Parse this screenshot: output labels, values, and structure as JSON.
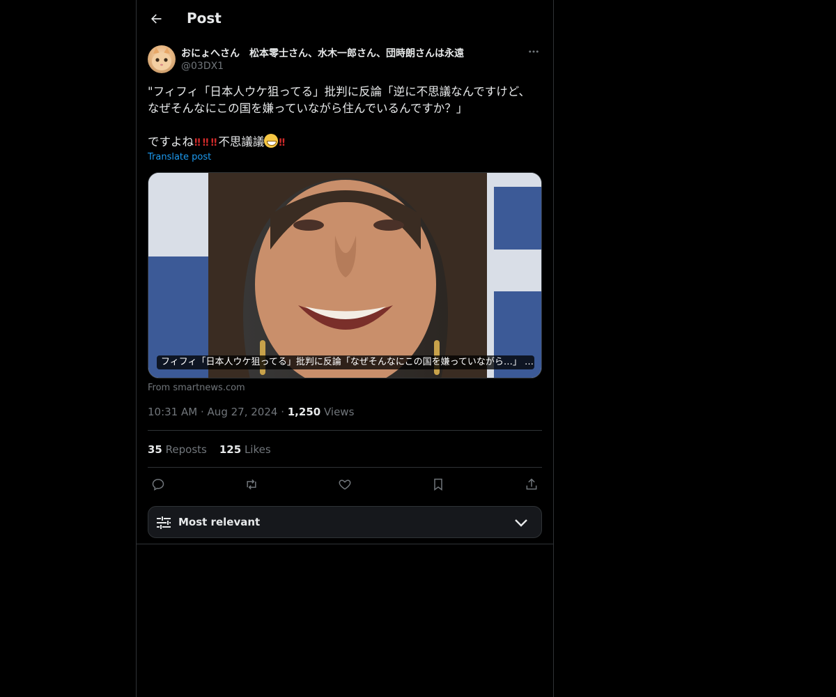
{
  "header": {
    "title": "Post",
    "back_icon": "arrow-left-icon"
  },
  "post": {
    "author": {
      "display_name": "おにょへさん　松本零士さん、水木一郎さん、団時朗さんは永遠",
      "handle": "@03DX1",
      "avatar": "cat-avatar"
    },
    "text_line1": "\"フィフィ「日本人ウケ狙ってる」批判に反論「逆に不思議なんですけど、",
    "text_line2": "なぜそんなにこの国を嫌っていながら住んでいるんですか？」",
    "text_line3_a": "ですよね",
    "text_line3_b": "不思議議",
    "bangs": "‼",
    "translate_label": "Translate post",
    "media": {
      "caption": "フィフィ「日本人ウケ狙ってる」批判に反論「なぜそんなにこの国を嫌っていながら…」 …",
      "source": "From smartnews.com"
    },
    "time": "10:31 AM",
    "date": "Aug 27, 2024",
    "separator": "·",
    "views_count": "1,250",
    "views_label": "Views",
    "reposts_count": "35",
    "reposts_label": "Reposts",
    "likes_count": "125",
    "likes_label": "Likes"
  },
  "actions": [
    "reply-icon",
    "repost-icon",
    "like-icon",
    "bookmark-icon",
    "share-icon"
  ],
  "sort": {
    "label": "Most relevant",
    "icon": "sliders-icon",
    "chevron": "chevron-down-icon"
  },
  "colors": {
    "background": "#000000",
    "text": "#e7e9ea",
    "muted": "#71767b",
    "accent": "#1d9bf0",
    "border": "#2f3336"
  }
}
